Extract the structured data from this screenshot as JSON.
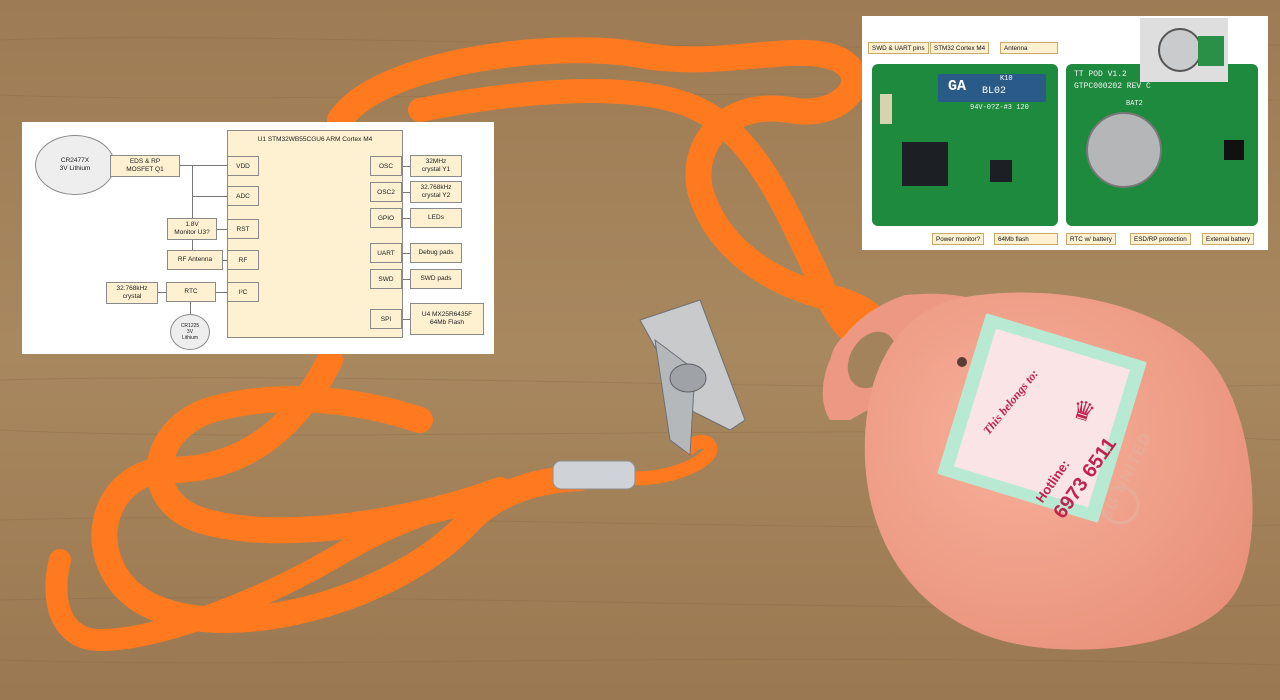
{
  "block_diagram": {
    "mcu_title": "U1 STM32WB55CGU6 ARM Cortex M4",
    "battery": "CR2477X\n3V Lithium",
    "eds": "EDS & RP\nMOSFET Q1",
    "monitor": "1.8V\nMonitor U3?",
    "rf_antenna": "RF Antenna",
    "rtc_crystal": "32.768kHz\ncrystal",
    "rtc": "RTC",
    "coin_cell": "CR1225\n3V\nLithium",
    "pins_left": [
      "VDD",
      "ADC",
      "RST",
      "RF",
      "I²C"
    ],
    "pins_right": [
      "OSC",
      "OSC2",
      "GPIO",
      "UART",
      "SWD",
      "SPI"
    ],
    "periph": [
      "32MHz\ncrystal Y1",
      "32.768kHz\ncrystal Y2",
      "LEDs",
      "Debug pads",
      "SWD pads",
      "U4 MX25R6435F\n64Mb Flash"
    ]
  },
  "pcb_inset": {
    "labels_top": [
      "SWD & UART pins",
      "STM32 Cortex M4",
      "Antenna"
    ],
    "labels_bottom": [
      "Power monitor?",
      "64Mb flash",
      "RTC w/ battery",
      "ESD/RP protection",
      "External battery"
    ],
    "silk_antenna": "GA",
    "silk_antenna_code": "BL02",
    "silk_antenna_sub": "K10",
    "silk_board1": "TT POD V1.2",
    "silk_board2": "GTPC000202 REV C",
    "silk_bat": "BAT2",
    "silk_lot": "94V-0?Z-#3 120"
  },
  "device": {
    "sticker_title": "This belongs to:",
    "hotline_label": "Hotline:",
    "hotline_number": "6973 6511",
    "brand": "SG UNITED"
  },
  "colors": {
    "table": "#a3835c",
    "lanyard": "#ff7a1e",
    "device": "#f4a08a",
    "pcb": "#1d8a3e"
  }
}
